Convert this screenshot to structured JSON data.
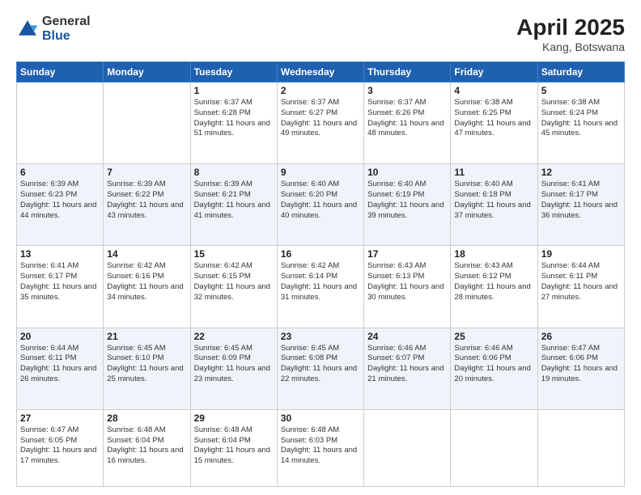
{
  "header": {
    "logo_line1": "General",
    "logo_line2": "Blue",
    "title": "April 2025",
    "location": "Kang, Botswana"
  },
  "days_of_week": [
    "Sunday",
    "Monday",
    "Tuesday",
    "Wednesday",
    "Thursday",
    "Friday",
    "Saturday"
  ],
  "weeks": [
    [
      {
        "day": "",
        "info": ""
      },
      {
        "day": "",
        "info": ""
      },
      {
        "day": "1",
        "info": "Sunrise: 6:37 AM\nSunset: 6:28 PM\nDaylight: 11 hours and 51 minutes."
      },
      {
        "day": "2",
        "info": "Sunrise: 6:37 AM\nSunset: 6:27 PM\nDaylight: 11 hours and 49 minutes."
      },
      {
        "day": "3",
        "info": "Sunrise: 6:37 AM\nSunset: 6:26 PM\nDaylight: 11 hours and 48 minutes."
      },
      {
        "day": "4",
        "info": "Sunrise: 6:38 AM\nSunset: 6:25 PM\nDaylight: 11 hours and 47 minutes."
      },
      {
        "day": "5",
        "info": "Sunrise: 6:38 AM\nSunset: 6:24 PM\nDaylight: 11 hours and 45 minutes."
      }
    ],
    [
      {
        "day": "6",
        "info": "Sunrise: 6:39 AM\nSunset: 6:23 PM\nDaylight: 11 hours and 44 minutes."
      },
      {
        "day": "7",
        "info": "Sunrise: 6:39 AM\nSunset: 6:22 PM\nDaylight: 11 hours and 43 minutes."
      },
      {
        "day": "8",
        "info": "Sunrise: 6:39 AM\nSunset: 6:21 PM\nDaylight: 11 hours and 41 minutes."
      },
      {
        "day": "9",
        "info": "Sunrise: 6:40 AM\nSunset: 6:20 PM\nDaylight: 11 hours and 40 minutes."
      },
      {
        "day": "10",
        "info": "Sunrise: 6:40 AM\nSunset: 6:19 PM\nDaylight: 11 hours and 39 minutes."
      },
      {
        "day": "11",
        "info": "Sunrise: 6:40 AM\nSunset: 6:18 PM\nDaylight: 11 hours and 37 minutes."
      },
      {
        "day": "12",
        "info": "Sunrise: 6:41 AM\nSunset: 6:17 PM\nDaylight: 11 hours and 36 minutes."
      }
    ],
    [
      {
        "day": "13",
        "info": "Sunrise: 6:41 AM\nSunset: 6:17 PM\nDaylight: 11 hours and 35 minutes."
      },
      {
        "day": "14",
        "info": "Sunrise: 6:42 AM\nSunset: 6:16 PM\nDaylight: 11 hours and 34 minutes."
      },
      {
        "day": "15",
        "info": "Sunrise: 6:42 AM\nSunset: 6:15 PM\nDaylight: 11 hours and 32 minutes."
      },
      {
        "day": "16",
        "info": "Sunrise: 6:42 AM\nSunset: 6:14 PM\nDaylight: 11 hours and 31 minutes."
      },
      {
        "day": "17",
        "info": "Sunrise: 6:43 AM\nSunset: 6:13 PM\nDaylight: 11 hours and 30 minutes."
      },
      {
        "day": "18",
        "info": "Sunrise: 6:43 AM\nSunset: 6:12 PM\nDaylight: 11 hours and 28 minutes."
      },
      {
        "day": "19",
        "info": "Sunrise: 6:44 AM\nSunset: 6:11 PM\nDaylight: 11 hours and 27 minutes."
      }
    ],
    [
      {
        "day": "20",
        "info": "Sunrise: 6:44 AM\nSunset: 6:11 PM\nDaylight: 11 hours and 26 minutes."
      },
      {
        "day": "21",
        "info": "Sunrise: 6:45 AM\nSunset: 6:10 PM\nDaylight: 11 hours and 25 minutes."
      },
      {
        "day": "22",
        "info": "Sunrise: 6:45 AM\nSunset: 6:09 PM\nDaylight: 11 hours and 23 minutes."
      },
      {
        "day": "23",
        "info": "Sunrise: 6:45 AM\nSunset: 6:08 PM\nDaylight: 11 hours and 22 minutes."
      },
      {
        "day": "24",
        "info": "Sunrise: 6:46 AM\nSunset: 6:07 PM\nDaylight: 11 hours and 21 minutes."
      },
      {
        "day": "25",
        "info": "Sunrise: 6:46 AM\nSunset: 6:06 PM\nDaylight: 11 hours and 20 minutes."
      },
      {
        "day": "26",
        "info": "Sunrise: 6:47 AM\nSunset: 6:06 PM\nDaylight: 11 hours and 19 minutes."
      }
    ],
    [
      {
        "day": "27",
        "info": "Sunrise: 6:47 AM\nSunset: 6:05 PM\nDaylight: 11 hours and 17 minutes."
      },
      {
        "day": "28",
        "info": "Sunrise: 6:48 AM\nSunset: 6:04 PM\nDaylight: 11 hours and 16 minutes."
      },
      {
        "day": "29",
        "info": "Sunrise: 6:48 AM\nSunset: 6:04 PM\nDaylight: 11 hours and 15 minutes."
      },
      {
        "day": "30",
        "info": "Sunrise: 6:48 AM\nSunset: 6:03 PM\nDaylight: 11 hours and 14 minutes."
      },
      {
        "day": "",
        "info": ""
      },
      {
        "day": "",
        "info": ""
      },
      {
        "day": "",
        "info": ""
      }
    ]
  ]
}
